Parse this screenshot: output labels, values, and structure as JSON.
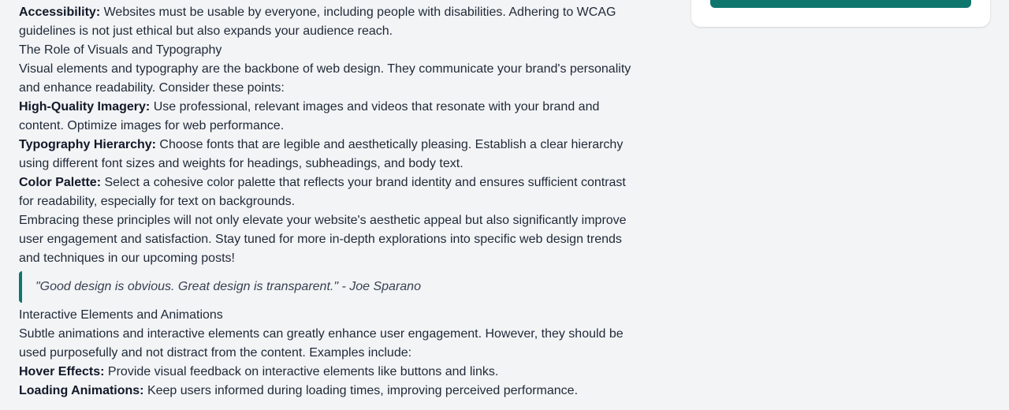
{
  "article": {
    "accessibility": {
      "term": "Accessibility:",
      "text": " Websites must be usable by everyone, including people with disabilities. Adhering to WCAG guidelines is not just ethical but also expands your audience reach."
    },
    "visuals_heading": "The Role of Visuals and Typography",
    "visuals_intro": "Visual elements and typography are the backbone of web design. They communicate your brand's personality and enhance readability. Consider these points:",
    "imagery": {
      "term": "High-Quality Imagery:",
      "text": " Use professional, relevant images and videos that resonate with your brand and content. Optimize images for web performance."
    },
    "typography": {
      "term": "Typography Hierarchy:",
      "text": " Choose fonts that are legible and aesthetically pleasing. Establish a clear hierarchy using different font sizes and weights for headings, subheadings, and body text."
    },
    "color": {
      "term": "Color Palette:",
      "text": " Select a cohesive color palette that reflects your brand identity and ensures sufficient contrast for readability, especially for text on backgrounds."
    },
    "embracing": "Embracing these principles will not only elevate your website's aesthetic appeal but also significantly improve user engagement and satisfaction. Stay tuned for more in-depth explorations into specific web design trends and techniques in our upcoming posts!",
    "quote": "\"Good design is obvious. Great design is transparent.\" - Joe Sparano",
    "interactive_heading": "Interactive Elements and Animations",
    "interactive_intro": "Subtle animations and interactive elements can greatly enhance user engagement. However, they should be used purposefully and not distract from the content. Examples include:",
    "hover": {
      "term": "Hover Effects:",
      "text": " Provide visual feedback on interactive elements like buttons and links."
    },
    "loading": {
      "term": "Loading Animations:",
      "text": " Keep users informed during loading times, improving perceived performance."
    }
  },
  "colors": {
    "accent": "#0f766e",
    "background": "#f3f4f6",
    "text": "#1f2937",
    "card": "#ffffff"
  }
}
